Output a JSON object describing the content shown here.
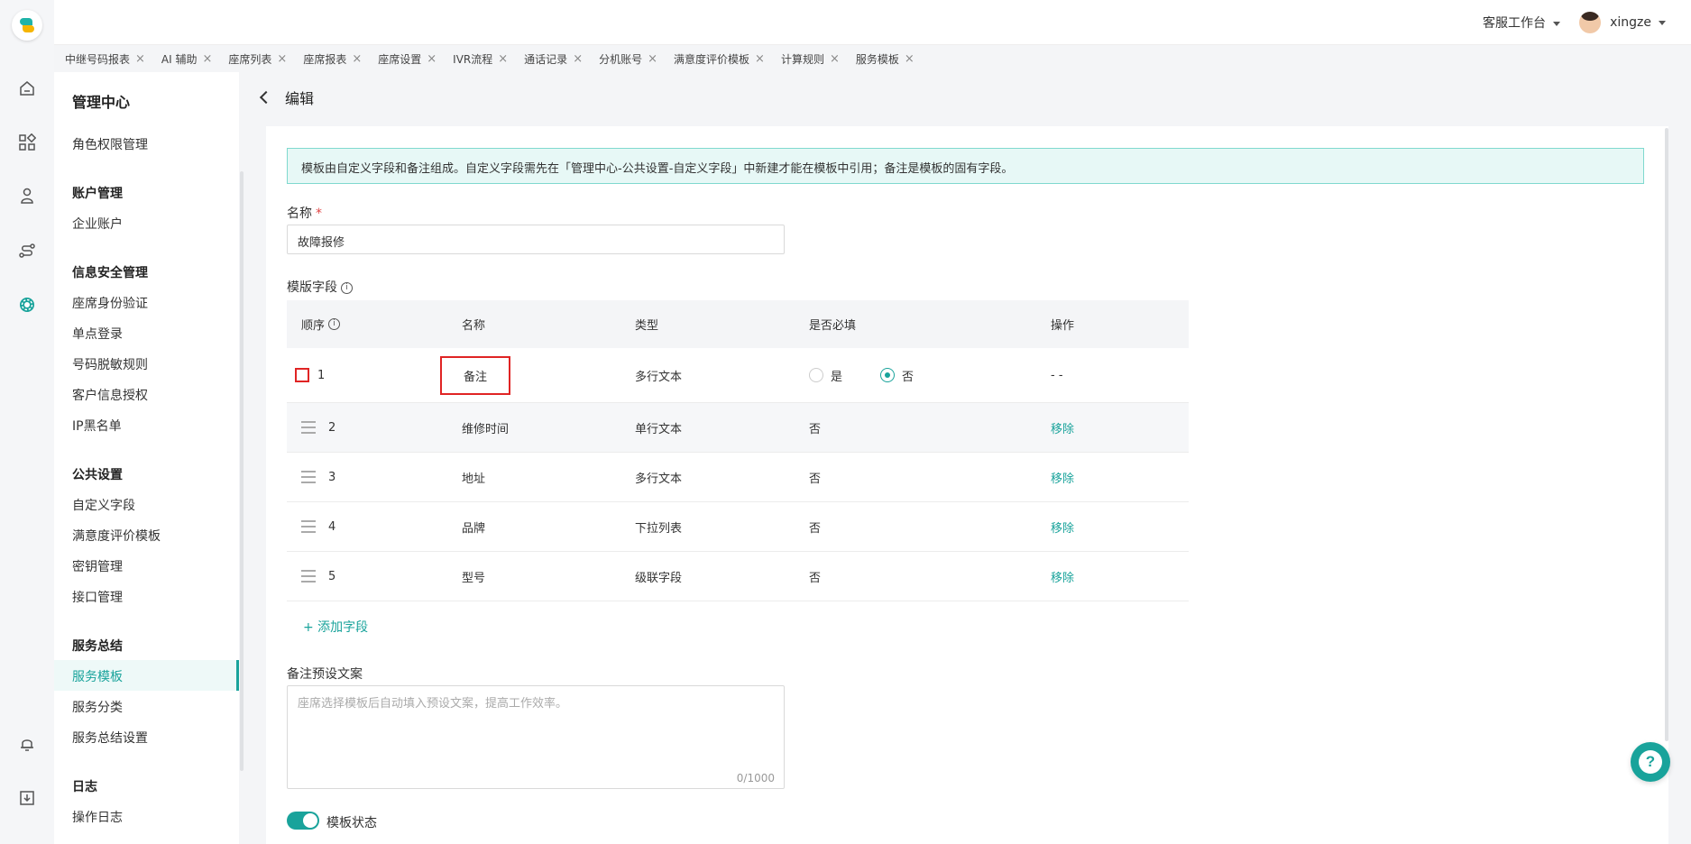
{
  "header": {
    "workspace_label": "客服工作台",
    "username": "xingze"
  },
  "tabs": [
    {
      "label": "中继号码报表"
    },
    {
      "label": "AI 辅助"
    },
    {
      "label": "座席列表"
    },
    {
      "label": "座席报表"
    },
    {
      "label": "座席设置"
    },
    {
      "label": "IVR流程"
    },
    {
      "label": "通话记录"
    },
    {
      "label": "分机账号"
    },
    {
      "label": "满意度评价模板"
    },
    {
      "label": "计算规则"
    },
    {
      "label": "服务模板"
    }
  ],
  "sidebar": {
    "title": "管理中心",
    "role_item": "角色权限管理",
    "groups": [
      {
        "title": "账户管理",
        "items": [
          "企业账户"
        ]
      },
      {
        "title": "信息安全管理",
        "items": [
          "座席身份验证",
          "单点登录",
          "号码脱敏规则",
          "客户信息授权",
          "IP黑名单"
        ]
      },
      {
        "title": "公共设置",
        "items": [
          "自定义字段",
          "满意度评价模板",
          "密钥管理",
          "接口管理"
        ]
      },
      {
        "title": "服务总结",
        "items": [
          "服务模板",
          "服务分类",
          "服务总结设置"
        ]
      },
      {
        "title": "日志",
        "items": [
          "操作日志"
        ]
      }
    ],
    "active_item": "服务模板"
  },
  "page": {
    "title": "编辑",
    "notice": "模板由自定义字段和备注组成。自定义字段需先在「管理中心-公共设置-自定义字段」中新建才能在模板中引用；备注是模板的固有字段。",
    "name_label": "名称",
    "required_mark": "*",
    "name_value": "故障报修",
    "fields_label": "模版字段",
    "add_field_label": "+ 添加字段",
    "remark_label": "备注预设文案",
    "remark_placeholder": "座席选择模板后自动填入预设文案，提高工作效率。",
    "remark_counter": "0/1000",
    "status_label": "模板状态"
  },
  "table": {
    "headers": [
      "顺序",
      "名称",
      "类型",
      "是否必填",
      "操作"
    ],
    "rows": [
      {
        "order": "1",
        "name": "备注",
        "type": "多行文本",
        "required": "",
        "action": "- -"
      },
      {
        "order": "2",
        "name": "维修时间",
        "type": "单行文本",
        "required": "否",
        "action": "移除"
      },
      {
        "order": "3",
        "name": "地址",
        "type": "多行文本",
        "required": "否",
        "action": "移除"
      },
      {
        "order": "4",
        "name": "品牌",
        "type": "下拉列表",
        "required": "否",
        "action": "移除"
      },
      {
        "order": "5",
        "name": "型号",
        "type": "级联字段",
        "required": "否",
        "action": "移除"
      }
    ],
    "radio_yes": "是",
    "radio_no": "否",
    "radio_selected": "否"
  },
  "colors": {
    "accent": "#19a39b",
    "highlight_border": "#e02424"
  }
}
